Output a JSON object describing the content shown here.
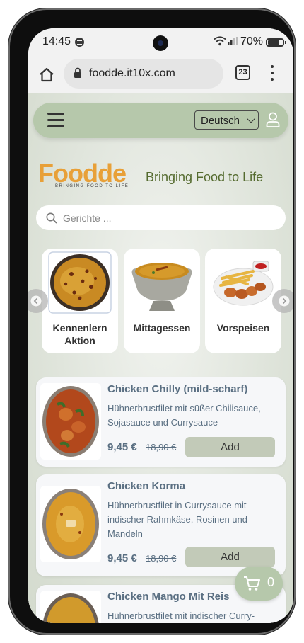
{
  "status_bar": {
    "time": "14:45",
    "battery": "70%"
  },
  "browser": {
    "url": "foodde.it10x.com",
    "tab_count": "23"
  },
  "navbar": {
    "language": "Deutsch"
  },
  "brand": {
    "logo_text": "Foodde",
    "logo_subtitle": "BRINGING FOOD TO LIFE",
    "tagline": "Bringing Food to Life",
    "accent_color": "#b6c8ab"
  },
  "search": {
    "placeholder": "Gerichte ..."
  },
  "categories": [
    {
      "label": "Kennenlern Aktion",
      "icon": "curry-bowl-image"
    },
    {
      "label": "Mittagessen",
      "icon": "curry-pot-image"
    },
    {
      "label": "Vorspeisen",
      "icon": "fries-plate-image"
    }
  ],
  "products": [
    {
      "title": "Chicken Chilly (mild-scharf)",
      "description": "Hühnerbrustfilet mit süßer Chilisauce, Sojasauce und Currysauce",
      "price": "9,45 €",
      "old_price": "18,90 €",
      "add_label": "Add"
    },
    {
      "title": "Chicken Korma",
      "description": "Hühnerbrustfilet in Currysauce mit indischer Rahmkäse, Rosinen und Mandeln",
      "price": "9,45 €",
      "old_price": "18,90 €",
      "add_label": "Add"
    },
    {
      "title": "Chicken Mango Mit Reis",
      "description": "Hühnerbrustfilet mit indischer Curry-"
    }
  ],
  "cart": {
    "count": "0"
  }
}
